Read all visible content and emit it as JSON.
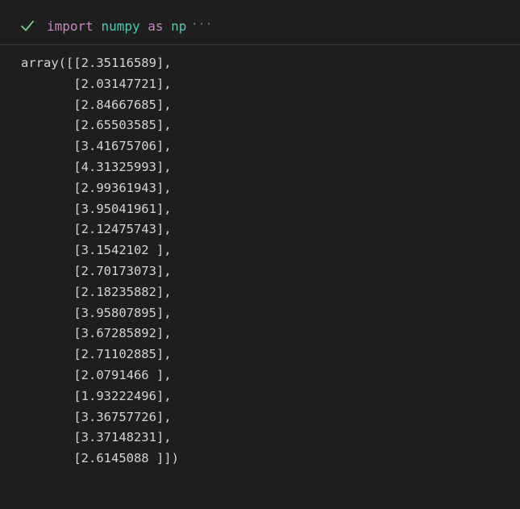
{
  "cell": {
    "status": "success",
    "status_icon": "check-icon",
    "status_color": "#73c991",
    "code": {
      "kw1": "import",
      "module": "numpy",
      "kw2": "as",
      "alias": "np",
      "collapsed_indicator": "···"
    }
  },
  "output": {
    "lines": [
      "array([[2.35116589],",
      "       [2.03147721],",
      "       [2.84667685],",
      "       [2.65503585],",
      "       [3.41675706],",
      "       [4.31325993],",
      "       [2.99361943],",
      "       [3.95041961],",
      "       [2.12475743],",
      "       [3.1542102 ],",
      "       [2.70173073],",
      "       [2.18235882],",
      "       [3.95807895],",
      "       [3.67285892],",
      "       [2.71102885],",
      "       [2.0791466 ],",
      "       [1.93222496],",
      "       [3.36757726],",
      "       [3.37148231],",
      "       [2.6145088 ]])"
    ]
  }
}
